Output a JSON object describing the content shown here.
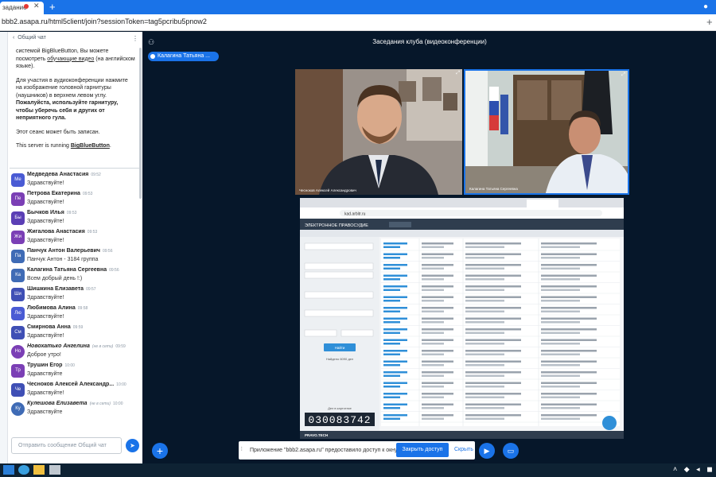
{
  "browser": {
    "tab_title": "заданиe",
    "url": "bbb2.asapa.ru/html5client/join?sessionToken=tag5pcribu5pnow2"
  },
  "chat": {
    "header": "Общий чат",
    "welcome": {
      "p1_a": "системой BigBlueButton, Вы можете посмотреть ",
      "p1_link": "обучающие видео",
      "p1_b": " (на английском языке).",
      "p2_a": "Для участия в аудиоконференции нажмите на изображение головной гарнитуры (наушников) в верхнем левом углу. ",
      "p2_b": "Пожалуйста, используйте гарнитуру, чтобы уберечь себя и других от неприятного гула.",
      "p3": "Этот сеанс может быть записан.",
      "p4_a": "This server is running ",
      "p4_link": "BigBlueButton",
      "p4_b": "."
    },
    "messages": [
      {
        "initials": "Ме",
        "name": "Медведева Анастасия",
        "time": "09:52",
        "text": "Здравствуйте!",
        "color": "#4a5bd4"
      },
      {
        "initials": "Пе",
        "name": "Петрова Екатерина",
        "time": "09:53",
        "text": "Здравствуйте!",
        "color": "#7b3fb5"
      },
      {
        "initials": "Бы",
        "name": "Бычков Илья",
        "time": "09:53",
        "text": "Здравствуйте!",
        "color": "#5b3fb5"
      },
      {
        "initials": "Жи",
        "name": "Жигалова Анастасия",
        "time": "09:53",
        "text": "Здравствуйте!",
        "color": "#7b3fb5"
      },
      {
        "initials": "Па",
        "name": "Панчук Антон Валерьевич",
        "time": "09:56",
        "text": "Панчук Антон - 3184 группа",
        "color": "#3f6bb5"
      },
      {
        "initials": "Ка",
        "name": "Калагина Татьяна Сергеевна",
        "time": "09:56",
        "text": "Всем добрый день !:)",
        "color": "#3f6bb5"
      },
      {
        "initials": "Ши",
        "name": "Шишкина Елизавета",
        "time": "09:57",
        "text": "Здравствуйте!",
        "color": "#3f4fb5"
      },
      {
        "initials": "Лю",
        "name": "Любимова Алина",
        "time": "09:58",
        "text": "Здравствуйте!",
        "color": "#4a5bd4"
      },
      {
        "initials": "См",
        "name": "Смирнова Анна",
        "time": "09:59",
        "text": "Здравствуйте!",
        "color": "#3f4fb5"
      },
      {
        "initials": "Но",
        "name": "Новохатько Ангелина",
        "offline_tag": "(не в сети)",
        "time": "09:59",
        "text": "Доброе утро!",
        "color": "#7b3fb5",
        "offline": true
      },
      {
        "initials": "Тр",
        "name": "Трушин Егор",
        "time": "10:00",
        "text": "Здравствуйте",
        "color": "#7b3fb5"
      },
      {
        "initials": "Че",
        "name": "Чесноков Алексей Александр...",
        "time": "10:00",
        "text": "Здравствуйте!",
        "color": "#3f4fb5"
      },
      {
        "initials": "Ку",
        "name": "Кулешова Елизавета",
        "offline_tag": "(не в сети)",
        "time": "10:00",
        "text": "Здравствуйте",
        "color": "#3f6bb5",
        "offline": true
      }
    ],
    "input_placeholder": "Отправить сообщение Общий чат"
  },
  "meeting": {
    "title": "Заседания клуба (видеоконференции)",
    "talking_user": "Калагина Татьяна ...",
    "videos": [
      {
        "name": "Чесноков Алексей Александрович"
      },
      {
        "name": "Калагина Татьяна Сергеевна"
      }
    ]
  },
  "screenshare": {
    "url": "kad.arbitr.ru",
    "site_title": "ЭЛЕКТРОННОЕ ПРАВОСУДИЕ",
    "counter": "030083742",
    "counter_label": "Дел в картотеке",
    "search_button": "Найти",
    "found_text": "Найдено 6090 дел",
    "footer_logo": "PRAVO.TECH"
  },
  "notice": {
    "text": "Приложение \"bbb2.asapa.ru\" предоставило доступ к окну.",
    "stop_label": "Закрыть доступ",
    "hide_label": "Скрыть"
  },
  "colors": {
    "accent": "#1a73e8",
    "background": "#06172a"
  }
}
